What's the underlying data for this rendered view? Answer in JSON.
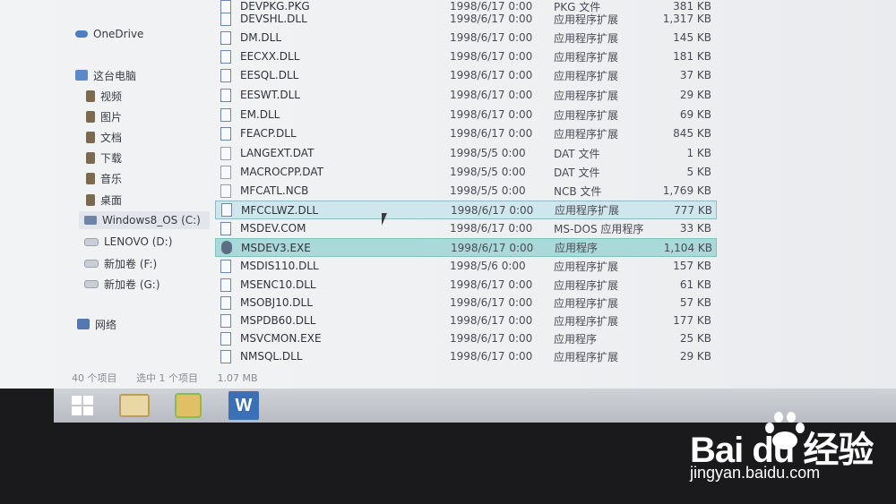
{
  "sidebar": {
    "items": [
      {
        "label": "OneDrive"
      },
      {
        "label": "这台电脑"
      },
      {
        "label": "视频"
      },
      {
        "label": "图片"
      },
      {
        "label": "文档"
      },
      {
        "label": "下载"
      },
      {
        "label": "音乐"
      },
      {
        "label": "桌面"
      },
      {
        "label": "Windows8_OS (C:)"
      },
      {
        "label": "LENOVO (D:)"
      },
      {
        "label": "新加卷 (F:)"
      },
      {
        "label": "新加卷 (G:)"
      },
      {
        "label": "网络"
      }
    ]
  },
  "files": [
    {
      "name": "DEVPKG.PKG",
      "date": "1998/6/17 0:00",
      "type": "PKG 文件",
      "size": "381 KB"
    },
    {
      "name": "DEVSHL.DLL",
      "date": "1998/6/17 0:00",
      "type": "应用程序扩展",
      "size": "1,317 KB"
    },
    {
      "name": "DM.DLL",
      "date": "1998/6/17 0:00",
      "type": "应用程序扩展",
      "size": "145 KB"
    },
    {
      "name": "EECXX.DLL",
      "date": "1998/6/17 0:00",
      "type": "应用程序扩展",
      "size": "181 KB"
    },
    {
      "name": "EESQL.DLL",
      "date": "1998/6/17 0:00",
      "type": "应用程序扩展",
      "size": "37 KB"
    },
    {
      "name": "EESWT.DLL",
      "date": "1998/6/17 0:00",
      "type": "应用程序扩展",
      "size": "29 KB"
    },
    {
      "name": "EM.DLL",
      "date": "1998/6/17 0:00",
      "type": "应用程序扩展",
      "size": "69 KB"
    },
    {
      "name": "FEACP.DLL",
      "date": "1998/6/17 0:00",
      "type": "应用程序扩展",
      "size": "845 KB"
    },
    {
      "name": "LANGEXT.DAT",
      "date": "1998/5/5 0:00",
      "type": "DAT 文件",
      "size": "1 KB"
    },
    {
      "name": "MACROCPP.DAT",
      "date": "1998/5/5 0:00",
      "type": "DAT 文件",
      "size": "5 KB"
    },
    {
      "name": "MFCATL.NCB",
      "date": "1998/5/5 0:00",
      "type": "NCB 文件",
      "size": "1,769 KB"
    },
    {
      "name": "MFCCLWZ.DLL",
      "date": "1998/6/17 0:00",
      "type": "应用程序扩展",
      "size": "777 KB"
    },
    {
      "name": "MSDEV.COM",
      "date": "1998/6/17 0:00",
      "type": "MS-DOS 应用程序",
      "size": "33 KB"
    },
    {
      "name": "MSDEV3.EXE",
      "date": "1998/6/17 0:00",
      "type": "应用程序",
      "size": "1,104 KB"
    },
    {
      "name": "MSDIS110.DLL",
      "date": "1998/5/6 0:00",
      "type": "应用程序扩展",
      "size": "157 KB"
    },
    {
      "name": "MSENC10.DLL",
      "date": "1998/6/17 0:00",
      "type": "应用程序扩展",
      "size": "61 KB"
    },
    {
      "name": "MSOBJ10.DLL",
      "date": "1998/6/17 0:00",
      "type": "应用程序扩展",
      "size": "57 KB"
    },
    {
      "name": "MSPDB60.DLL",
      "date": "1998/6/17 0:00",
      "type": "应用程序扩展",
      "size": "177 KB"
    },
    {
      "name": "MSVCMON.EXE",
      "date": "1998/6/17 0:00",
      "type": "应用程序",
      "size": "25 KB"
    },
    {
      "name": "NMSQL.DLL",
      "date": "1998/6/17 0:00",
      "type": "应用程序扩展",
      "size": "29 KB"
    }
  ],
  "status": {
    "count": "40 个项目",
    "selected": "选中 1 个项目",
    "size": "1.07 MB"
  },
  "taskbar": {
    "word_label": "W"
  },
  "watermark": {
    "logo": "Bai du 经验",
    "url": "jingyan.baidu.com"
  },
  "colors": {
    "selection": "#cfe6ec",
    "selection_strong": "#a9d9d9",
    "taskbar": "#c4c8cd"
  }
}
